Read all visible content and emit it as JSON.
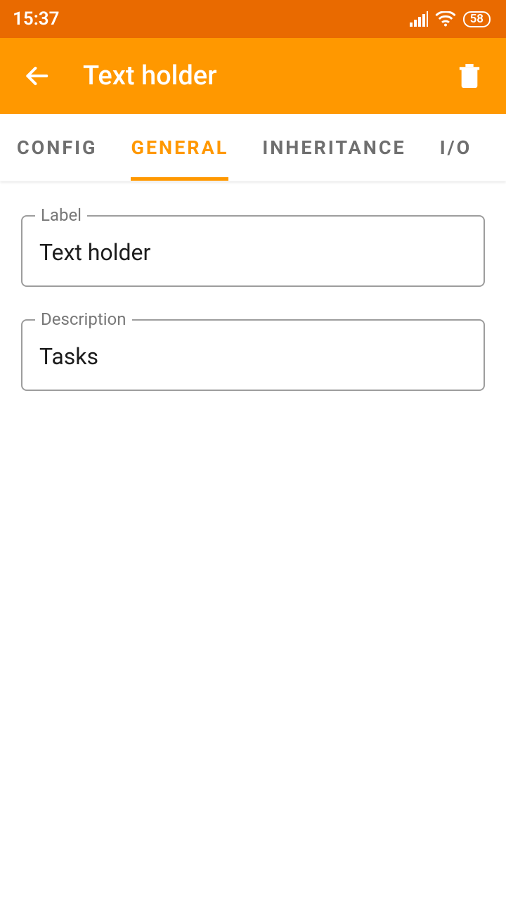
{
  "status": {
    "time": "15:37",
    "battery": "58"
  },
  "header": {
    "title": "Text holder"
  },
  "tabs": {
    "items": [
      {
        "label": "Config"
      },
      {
        "label": "General"
      },
      {
        "label": "Inheritance"
      },
      {
        "label": "I/O"
      }
    ],
    "active_index": 1
  },
  "form": {
    "label": {
      "caption": "Label",
      "value": "Text holder"
    },
    "description": {
      "caption": "Description",
      "value": "Tasks"
    }
  }
}
